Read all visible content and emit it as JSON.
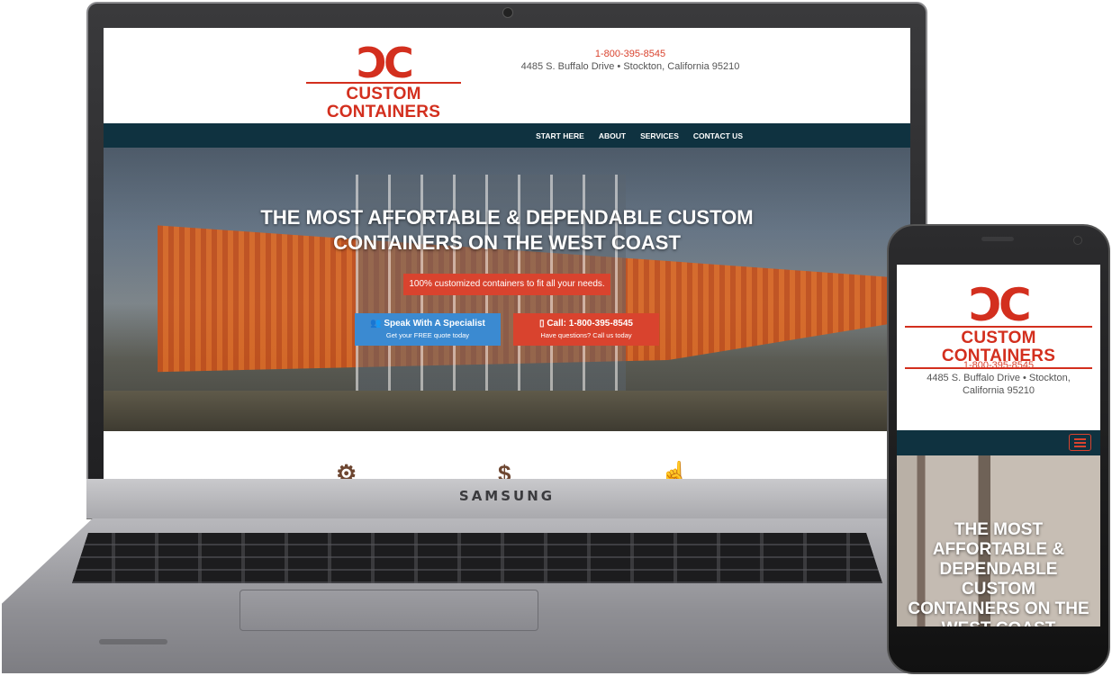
{
  "laptop": {
    "brand": "SAMSUNG"
  },
  "site": {
    "logo_mark": "ƆC",
    "logo_text": "CUSTOM CONTAINERS",
    "phone": "1-800-395-8545",
    "address": "4485 S. Buffalo Drive • Stockton, California 95210",
    "nav": [
      "START HERE",
      "ABOUT",
      "SERVICES",
      "CONTACT US"
    ],
    "hero": {
      "title_line1": "THE MOST AFFORTABLE & DEPENDABLE CUSTOM",
      "title_line2": "CONTAINERS ON THE WEST COAST",
      "tagline": "100% customized containers to fit all your needs.",
      "cta_primary_label": "👥 Speak With A Specialist",
      "cta_primary_sub": "Get your FREE quote today",
      "cta_secondary_label": "▯ Call: 1-800-395-8545",
      "cta_secondary_sub": "Have questions? Call us today"
    },
    "feature_icons": [
      "gear-icon",
      "dollar-icon",
      "thumbs-up-icon"
    ]
  },
  "mobile": {
    "logo_mark": "ƆC",
    "logo_text": "CUSTOM CONTAINERS",
    "phone": "1-800-395-8545",
    "address": "4485 S. Buffalo Drive • Stockton, California 95210",
    "hero_title": "THE MOST AFFORTABLE & DEPENDABLE CUSTOM CONTAINERS ON THE WEST COAST"
  },
  "colors": {
    "brand_red": "#d32f1e",
    "nav_navy": "#0f3240",
    "cta_blue": "#3b8ad1",
    "accent_red": "#d9432e"
  }
}
